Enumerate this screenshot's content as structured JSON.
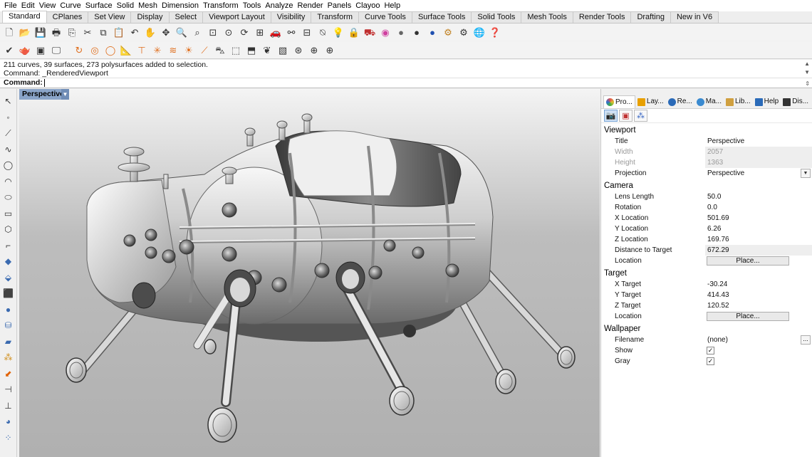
{
  "menu": [
    "File",
    "Edit",
    "View",
    "Curve",
    "Surface",
    "Solid",
    "Mesh",
    "Dimension",
    "Transform",
    "Tools",
    "Analyze",
    "Render",
    "Panels",
    "Clayoo",
    "Help"
  ],
  "tabs": [
    "Standard",
    "CPlanes",
    "Set View",
    "Display",
    "Select",
    "Viewport Layout",
    "Visibility",
    "Transform",
    "Curve Tools",
    "Surface Tools",
    "Solid Tools",
    "Mesh Tools",
    "Render Tools",
    "Drafting",
    "New in V6"
  ],
  "toolbar_row1": [
    "new-icon",
    "open-icon",
    "save-icon",
    "print-icon",
    "import-icon",
    "cut-icon",
    "copy-icon",
    "paste-icon",
    "undo-icon",
    "pan-icon",
    "move-icon",
    "zoom-icon",
    "zoom-window-icon",
    "zoom-extents-icon",
    "zoom-selected-icon",
    "rotate-view-icon",
    "four-viewports-icon",
    "car-icon",
    "lights-icon",
    "grid-icon",
    "cplane-icon",
    "light-bulb-icon",
    "lock-icon",
    "car-properties-icon",
    "color-wheel-icon",
    "sphere-icon",
    "sphere-render-icon",
    "sphere-blue-icon",
    "gears-icon",
    "options-icon",
    "globe-icon",
    "help-icon"
  ],
  "toolbar_row2": [
    "check-icon",
    "teapot-icon",
    "render-icon",
    "screen-icon",
    "lasso-icon",
    "point-icon",
    "circle-icon",
    "ruler-icon",
    "project-icon",
    "explode-icon",
    "smooth-icon",
    "sun-icon",
    "trim-icon",
    "car-icon",
    "box-icon",
    "box-edit-icon",
    "plant-icon",
    "texture-icon",
    "mesh-icon",
    "sphere-grid-icon",
    "snap-icon"
  ],
  "command_history": [
    "211 curves, 39 surfaces, 273 polysurfaces added to selection.",
    "Command: _RenderedViewport"
  ],
  "command_prompt": "Command:",
  "viewport": {
    "title": "Perspective"
  },
  "left_tools": [
    "select-arrow-icon",
    "point-icon",
    "polyline-icon",
    "curve-icon",
    "circle-icon",
    "arc-icon",
    "ellipse-icon",
    "rectangle-icon",
    "polygon-icon",
    "fillet-icon",
    "surface-icon",
    "extrude-icon",
    "solid-box-icon",
    "sphere-icon",
    "cylinder-icon",
    "mesh-icon",
    "gumball-icon",
    "transform-icon",
    "dimension-icon",
    "text-icon",
    "render-icon",
    "group-icon"
  ],
  "panel": {
    "tabs": [
      {
        "label": "Pro...",
        "color": "#e05a00"
      },
      {
        "label": "Lay...",
        "color": "#e8a000"
      },
      {
        "label": "Re...",
        "color": "#2a6ab8"
      },
      {
        "label": "Ma...",
        "color": "#3a8ad0"
      },
      {
        "label": "Lib...",
        "color": "#d0a040"
      },
      {
        "label": "Help",
        "color": "#2a6ab8"
      },
      {
        "label": "Dis...",
        "color": "#333333"
      }
    ],
    "more": "›",
    "sections": {
      "viewport": {
        "heading": "Viewport",
        "title_label": "Title",
        "title_value": "Perspective",
        "width_label": "Width",
        "width_value": "2057",
        "height_label": "Height",
        "height_value": "1363",
        "projection_label": "Projection",
        "projection_value": "Perspective"
      },
      "camera": {
        "heading": "Camera",
        "lens_label": "Lens Length",
        "lens_value": "50.0",
        "rotation_label": "Rotation",
        "rotation_value": "0.0",
        "xloc_label": "X Location",
        "xloc_value": "501.69",
        "yloc_label": "Y Location",
        "yloc_value": "6.26",
        "zloc_label": "Z Location",
        "zloc_value": "169.76",
        "dist_label": "Distance to Target",
        "dist_value": "672.29",
        "loc_label": "Location",
        "loc_button": "Place..."
      },
      "target": {
        "heading": "Target",
        "xt_label": "X Target",
        "xt_value": "-30.24",
        "yt_label": "Y Target",
        "yt_value": "414.43",
        "zt_label": "Z Target",
        "zt_value": "120.52",
        "loc_label": "Location",
        "loc_button": "Place..."
      },
      "wallpaper": {
        "heading": "Wallpaper",
        "filename_label": "Filename",
        "filename_value": "(none)",
        "show_label": "Show",
        "show_checked": "✓",
        "gray_label": "Gray",
        "gray_checked": "✓"
      }
    }
  }
}
